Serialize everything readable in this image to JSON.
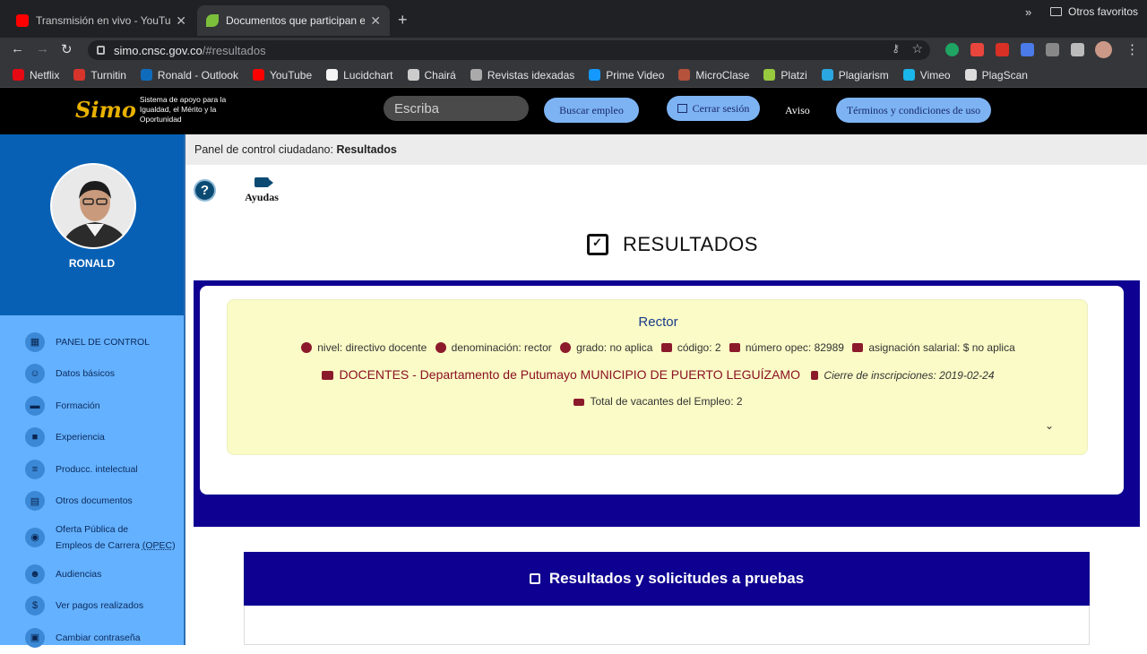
{
  "browser": {
    "tabs": [
      {
        "title": "Transmisión en vivo - YouTube"
      },
      {
        "title": "Documentos que participan en"
      }
    ],
    "url_host": "simo.cnsc.gov.co",
    "url_path": "/#resultados",
    "bookmarks": [
      {
        "label": "Netflix",
        "color": "#e50914"
      },
      {
        "label": "Turnitin",
        "color": "#d9342b"
      },
      {
        "label": "Ronald - Outlook",
        "color": "#0f6cbd"
      },
      {
        "label": "YouTube",
        "color": "#ff0000"
      },
      {
        "label": "Lucidchart",
        "color": "#f4f4f4"
      },
      {
        "label": "Chairá",
        "color": "#cccccc"
      },
      {
        "label": "Revistas idexadas",
        "color": "#aaaaaa"
      },
      {
        "label": "Prime Video",
        "color": "#1399ff"
      },
      {
        "label": "MicroClase",
        "color": "#b5523b"
      },
      {
        "label": "Platzi",
        "color": "#98ca3f"
      },
      {
        "label": "Plagiarism",
        "color": "#2ba6de"
      },
      {
        "label": "Vimeo",
        "color": "#1ab7ea"
      },
      {
        "label": "PlagScan",
        "color": "#dddddd"
      }
    ],
    "more": "»",
    "other_favorites": "Otros favoritos"
  },
  "header": {
    "logo_mark": "Simo",
    "logo_text": "Sistema de apoyo para la Igualdad, el Mérito y la Oportunidad",
    "search_placeholder": "Escriba",
    "buscar": "Buscar empleo",
    "cerrar": "Cerrar sesión",
    "aviso": "Aviso",
    "terminos": "Términos y condiciones de uso"
  },
  "sidebar": {
    "user": "RONALD",
    "items": [
      {
        "label": "PANEL DE CONTROL",
        "icon": "dashboard-icon"
      },
      {
        "label": "Datos básicos",
        "icon": "people-icon"
      },
      {
        "label": "Formación",
        "icon": "book-icon"
      },
      {
        "label": "Experiencia",
        "icon": "briefcase-icon"
      },
      {
        "label": "Producc. intelectual",
        "icon": "document-list-icon"
      },
      {
        "label": "Otros documentos",
        "icon": "file-icon"
      },
      {
        "label": "Oferta Pública de",
        "label2": "Empleos de Carrera",
        "abbr": "(OPEC)",
        "icon": "globe-icon"
      },
      {
        "label": "Audiencias",
        "icon": "audience-icon"
      },
      {
        "label": "Ver pagos realizados",
        "icon": "dollar-icon"
      },
      {
        "label": "Cambiar contraseña",
        "icon": "lock-icon"
      }
    ]
  },
  "breadcrumb": {
    "prefix": "Panel de control ciudadano: ",
    "current": "Resultados"
  },
  "help": {
    "label": "Ayudas"
  },
  "page_title": "RESULTADOS",
  "job": {
    "title": "Rector",
    "nivel": "nivel: directivo docente",
    "denominacion": "denominación: rector",
    "grado": "grado: no aplica",
    "codigo": "código: 2",
    "opec": "número opec: 82989",
    "salario": "asignación salarial: $ no aplica",
    "dependencia": "DOCENTES - Departamento de Putumayo MUNICIPIO DE PUERTO LEGUÍZAMO",
    "cierre": "Cierre de inscripciones: 2019-02-24",
    "vacantes": "Total de vacantes del Empleo: 2"
  },
  "section": {
    "title": "Resultados y solicitudes a pruebas"
  }
}
